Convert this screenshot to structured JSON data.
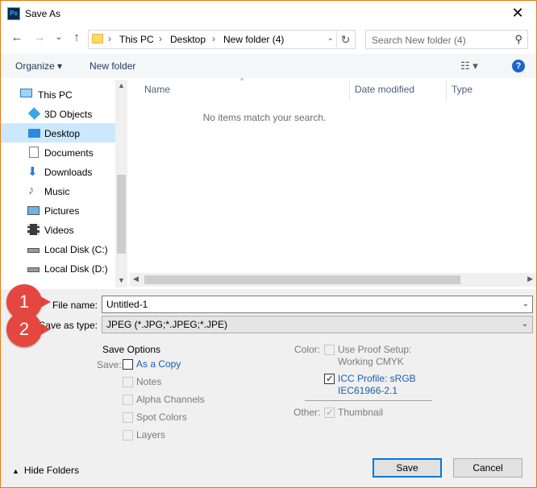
{
  "window": {
    "title": "Save As",
    "app_icon": "Ps",
    "close_glyph": "✕"
  },
  "nav": {
    "back": "←",
    "forward": "→",
    "recent": "⌄",
    "up": "↑",
    "breadcrumbs": [
      "This PC",
      "Desktop",
      "New folder (4)"
    ],
    "crumb_separator": "›",
    "refresh": "↻",
    "search_placeholder": "Search New folder (4)"
  },
  "command_bar": {
    "organize": "Organize ▾",
    "new_folder": "New folder",
    "help": "?"
  },
  "sidebar": {
    "items": [
      {
        "label": "This PC",
        "icon": "pc-icon"
      },
      {
        "label": "3D Objects",
        "icon": "cube-icon"
      },
      {
        "label": "Desktop",
        "icon": "desktop-icon",
        "selected": true
      },
      {
        "label": "Documents",
        "icon": "document-icon"
      },
      {
        "label": "Downloads",
        "icon": "download-icon"
      },
      {
        "label": "Music",
        "icon": "music-icon"
      },
      {
        "label": "Pictures",
        "icon": "pictures-icon"
      },
      {
        "label": "Videos",
        "icon": "video-icon"
      },
      {
        "label": "Local Disk (C:)",
        "icon": "disk-icon"
      },
      {
        "label": "Local Disk (D:)",
        "icon": "disk-icon"
      }
    ]
  },
  "file_list": {
    "columns": [
      "Name",
      "Date modified",
      "Type"
    ],
    "empty_message": "No items match your search."
  },
  "form": {
    "file_name_label": "File name:",
    "file_name_value": "Untitled-1",
    "save_type_label": "Save as type:",
    "save_type_value": "JPEG (*.JPG;*.JPEG;*.JPE)",
    "callouts": [
      "1",
      "2"
    ]
  },
  "save_options": {
    "heading": "Save Options",
    "save_label": "Save:",
    "as_copy": "As a Copy",
    "notes": "Notes",
    "alpha_channels": "Alpha Channels",
    "spot_colors": "Spot Colors",
    "layers": "Layers"
  },
  "color_options": {
    "color_label": "Color:",
    "use_proof_setup": "Use Proof Setup:",
    "working_cmyk": "Working CMYK",
    "icc_profile": "ICC Profile:  sRGB",
    "icc_profile_2": "IEC61966-2.1",
    "other_label": "Other:",
    "thumbnail": "Thumbnail"
  },
  "footer": {
    "hide_folders": "Hide Folders",
    "save": "Save",
    "cancel": "Cancel"
  },
  "colors": {
    "accent": "#0078d7",
    "selected_bg": "#cce8ff",
    "callout": "#e4473f",
    "window_border": "#e87b14"
  }
}
